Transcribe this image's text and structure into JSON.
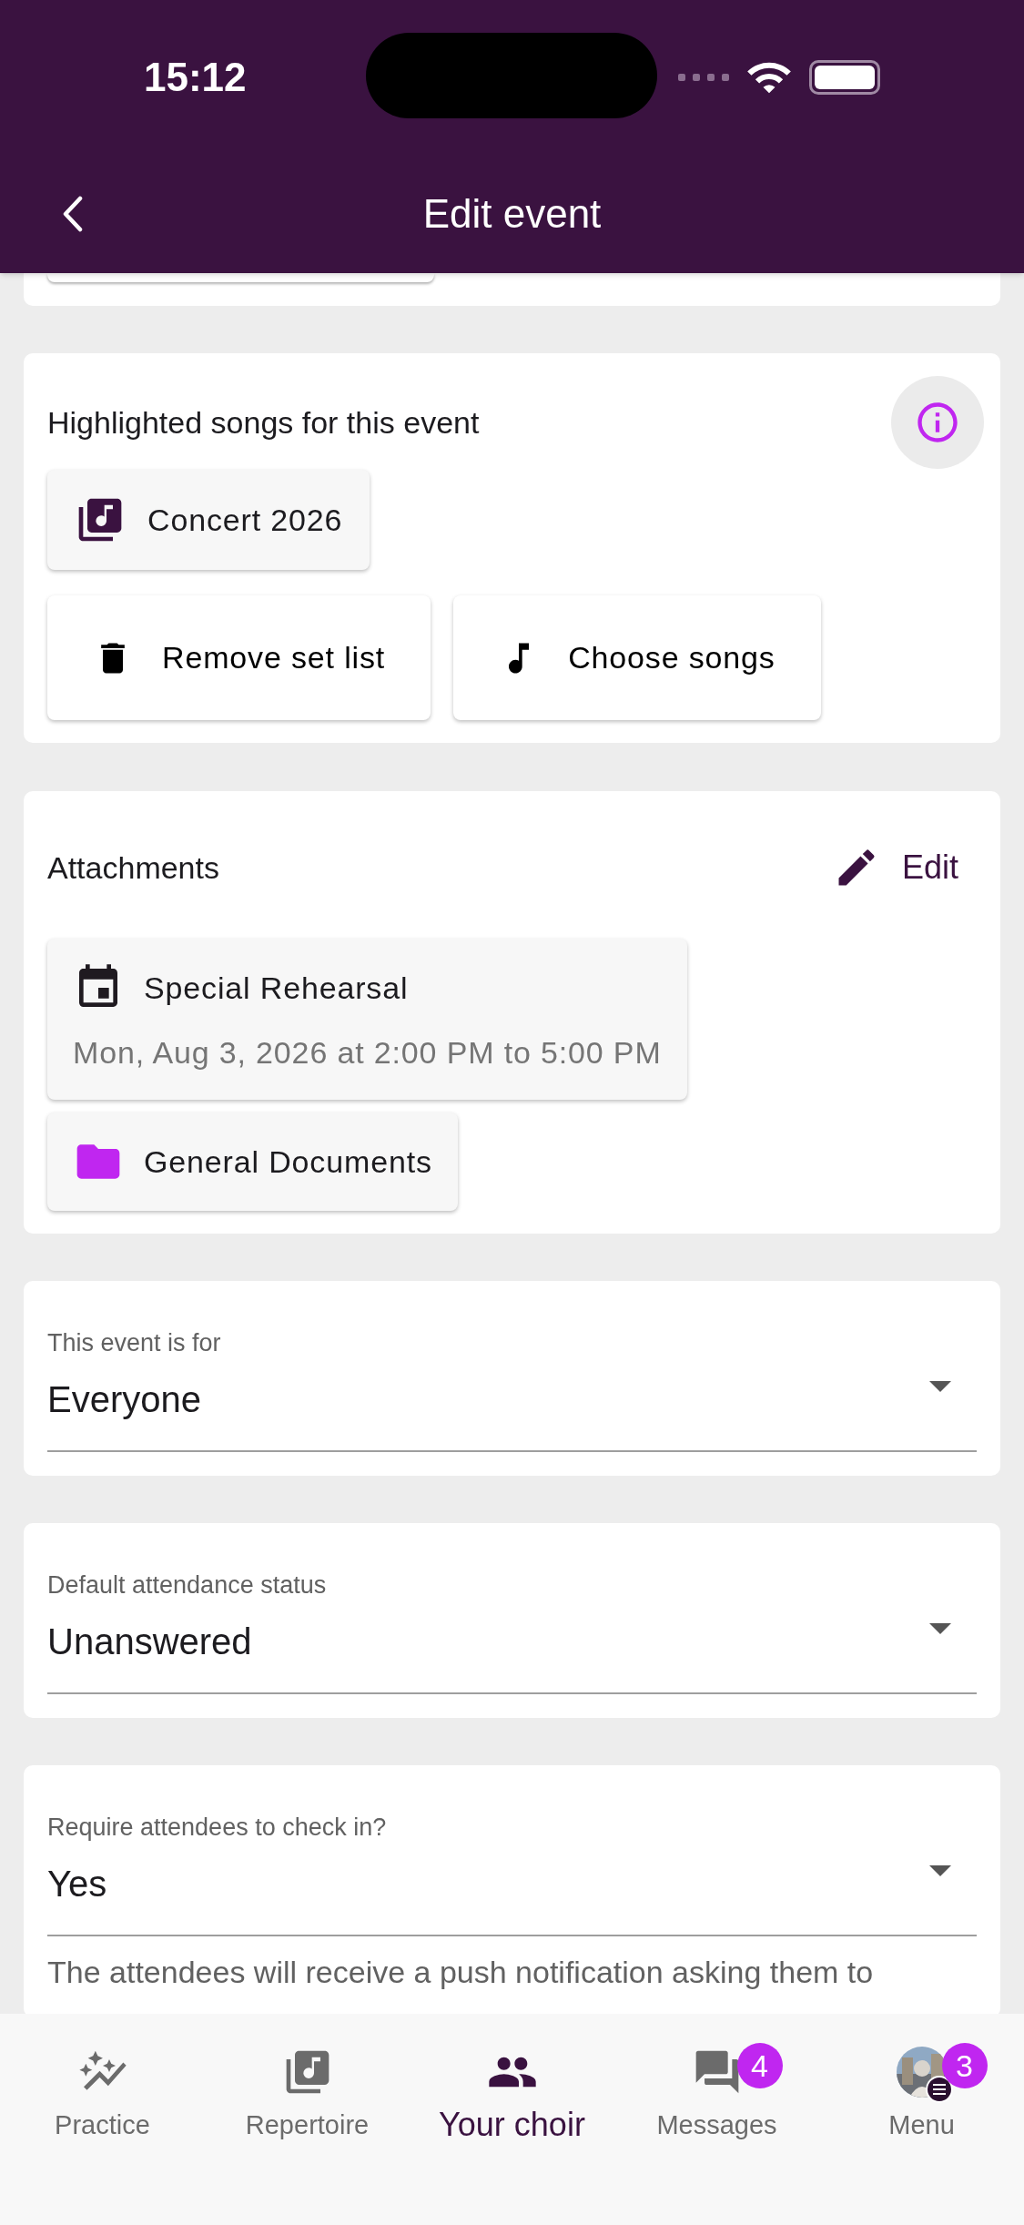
{
  "status_bar": {
    "time": "15:12"
  },
  "app_bar": {
    "title": "Edit event"
  },
  "highlighted_songs": {
    "label": "Highlighted songs for this event",
    "set_list": "Concert 2026",
    "buttons": [
      {
        "kind": "remove",
        "label": "Remove set list"
      },
      {
        "kind": "choose",
        "label": "Choose songs"
      }
    ]
  },
  "attachments": {
    "label": "Attachments",
    "edit_button": "Edit",
    "items": [
      {
        "kind": "event",
        "title": "Special Rehearsal",
        "subtitle": "Mon, Aug 3, 2026 at 2:00 PM to 5:00 PM"
      },
      {
        "kind": "folder",
        "title": "General Documents"
      }
    ]
  },
  "fields": [
    {
      "label": "This event is for",
      "value": "Everyone"
    },
    {
      "label": "Default attendance status",
      "value": "Unanswered"
    },
    {
      "label": "Require attendees to check in?",
      "value": "Yes",
      "help": "The attendees will receive a push notification asking them to"
    }
  ],
  "bottom_nav": [
    {
      "kind": "practice",
      "label": "Practice",
      "selected": false
    },
    {
      "kind": "repertoire",
      "label": "Repertoire",
      "selected": false
    },
    {
      "kind": "choir",
      "label": "Your choir",
      "selected": true
    },
    {
      "kind": "messages",
      "label": "Messages",
      "badge": "4",
      "selected": false
    },
    {
      "kind": "menu",
      "label": "Menu",
      "badge": "3",
      "selected": false
    }
  ]
}
